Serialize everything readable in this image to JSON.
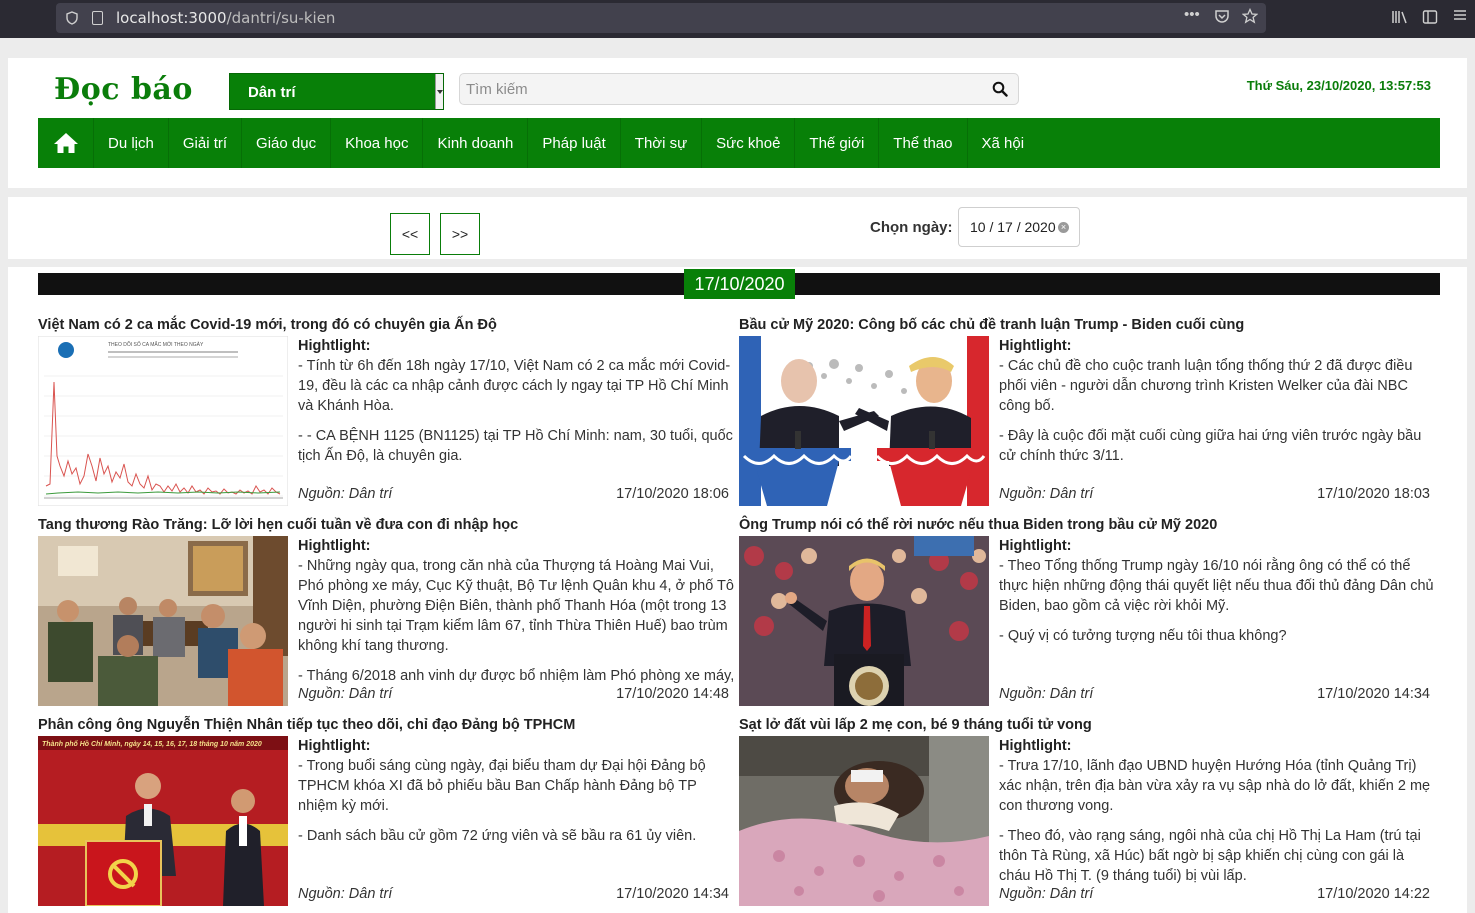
{
  "browser": {
    "url_host": "localhost:3000",
    "url_path": "/dantri/su-kien"
  },
  "header": {
    "logo": "Đọc báo",
    "source_selected": "Dân trí",
    "search_placeholder": "Tìm kiếm",
    "datetime": "Thứ Sáu, 23/10/2020, 13:57:53"
  },
  "nav": {
    "items": [
      "Du lịch",
      "Giải trí",
      "Giáo dục",
      "Khoa học",
      "Kinh doanh",
      "Pháp luật",
      "Thời sự",
      "Sức khoẻ",
      "Thế giới",
      "Thể thao",
      "Xã hội"
    ]
  },
  "datebar": {
    "prev_label": "<<",
    "next_label": ">>",
    "choose_label": "Chọn ngày:",
    "date_value": "10 / 17 / 2020"
  },
  "content": {
    "day_label": "17/10/2020",
    "highlight_label": "Hightlight:",
    "articles": [
      {
        "title": "Việt Nam có 2 ca mắc Covid-19 mới, trong đó có chuyên gia Ấn Độ",
        "paragraphs": [
          "- Tính từ 6h đến 18h ngày 17/10, Việt Nam có 2 ca mắc mới Covid-19, đều là các ca nhập cảnh được cách ly ngay tại TP Hồ Chí Minh và Khánh Hòa.",
          "- - CA BỆNH 1125 (BN1125) tại TP Hồ Chí Minh: nam, 30 tuổi, quốc tịch Ấn Độ, là chuyên gia."
        ],
        "source": "Nguồn: Dân trí",
        "time": "17/10/2020 18:06",
        "image": "covid-chart-image",
        "chart_caption": "THEO DÕI SỐ CA MẮC MỚI THEO NGÀY"
      },
      {
        "title": "Bầu cử Mỹ 2020: Công bố các chủ đề tranh luận Trump - Biden cuối cùng",
        "paragraphs": [
          "- Các chủ đề cho cuộc tranh luận tổng thống thứ 2 đã được điều phối viên - người dẫn chương trình Kristen Welker của đài NBC công bố.",
          "- Đây là cuộc đối mặt cuối cùng giữa hai ứng viên trước ngày bầu cử chính thức 3/11."
        ],
        "source": "Nguồn: Dân trí",
        "time": "17/10/2020 18:03",
        "image": "debate-image"
      },
      {
        "title": "Tang thương Rào Trăng: Lỡ lời hẹn cuối tuần về đưa con đi nhập học",
        "paragraphs": [
          "- Những ngày qua, trong căn nhà của Thượng tá Hoàng Mai Vui, Phó phòng xe máy, Cục Kỹ thuật, Bộ Tư lệnh Quân khu 4, ở phố Tô Vĩnh Diện, phường Điện Biên, thành phố Thanh Hóa (một trong 13 người hi sinh tại Trạm kiểm lâm 67, tỉnh Thừa Thiên Huế) bao trùm không khí tang thương.",
          "- Tháng 6/2018 anh vinh dự được bổ nhiệm làm Phó phòng xe máy,"
        ],
        "source": "Nguồn: Dân trí",
        "time": "17/10/2020 14:48",
        "image": "family-room-image"
      },
      {
        "title": "Ông Trump nói có thể rời nước nếu thua Biden trong bầu cử Mỹ 2020",
        "paragraphs": [
          "- Theo Tổng thống Trump ngày 16/10 nói rằng ông có thể có thể thực hiện những động thái quyết liệt nếu thua đối thủ đảng Dân chủ Biden, bao gồm cả việc rời khỏi Mỹ.",
          "- Quý vị có tưởng tượng nếu tôi thua không?"
        ],
        "source": "Nguồn: Dân trí",
        "time": "17/10/2020 14:34",
        "image": "rally-image"
      },
      {
        "title": "Phân công ông Nguyễn Thiện Nhân tiếp tục theo dõi, chỉ đạo Đảng bộ TPHCM",
        "paragraphs": [
          "- Trong buổi sáng cùng ngày, đại biểu tham dự Đại hội Đảng bộ TPHCM khóa XI đã bỏ phiếu bầu Ban Chấp hành Đảng bộ TP nhiệm kỳ mới.",
          "- Danh sách bầu cử gồm 72 ứng viên và sẽ bầu ra 61 ủy viên."
        ],
        "source": "Nguồn: Dân trí",
        "time": "17/10/2020 14:34",
        "image": "congress-image",
        "image_caption": "Thành phố Hồ Chí Minh, ngày 14, 15, 16, 17, 18 tháng 10 năm 2020"
      },
      {
        "title": "Sạt lở đất vùi lấp 2 mẹ con, bé 9 tháng tuổi tử vong",
        "paragraphs": [
          "- Trưa 17/10, lãnh đạo UBND huyện Hướng Hóa (tỉnh Quảng Trị) xác nhận, trên địa bàn vừa xảy ra vụ sập nhà do lở đất, khiến 2 mẹ con thương vong.",
          "- Theo đó, vào rạng sáng, ngôi nhà của chị Hồ Thị La Ham (trú tại thôn Tà Rùng, xã Húc) bất ngờ bị sập khiến chị cùng con gái là cháu Hồ Thị T. (9 tháng tuổi) bị vùi lấp."
        ],
        "source": "Nguồn: Dân trí",
        "time": "17/10/2020 14:22",
        "image": "injured-woman-image"
      }
    ]
  }
}
